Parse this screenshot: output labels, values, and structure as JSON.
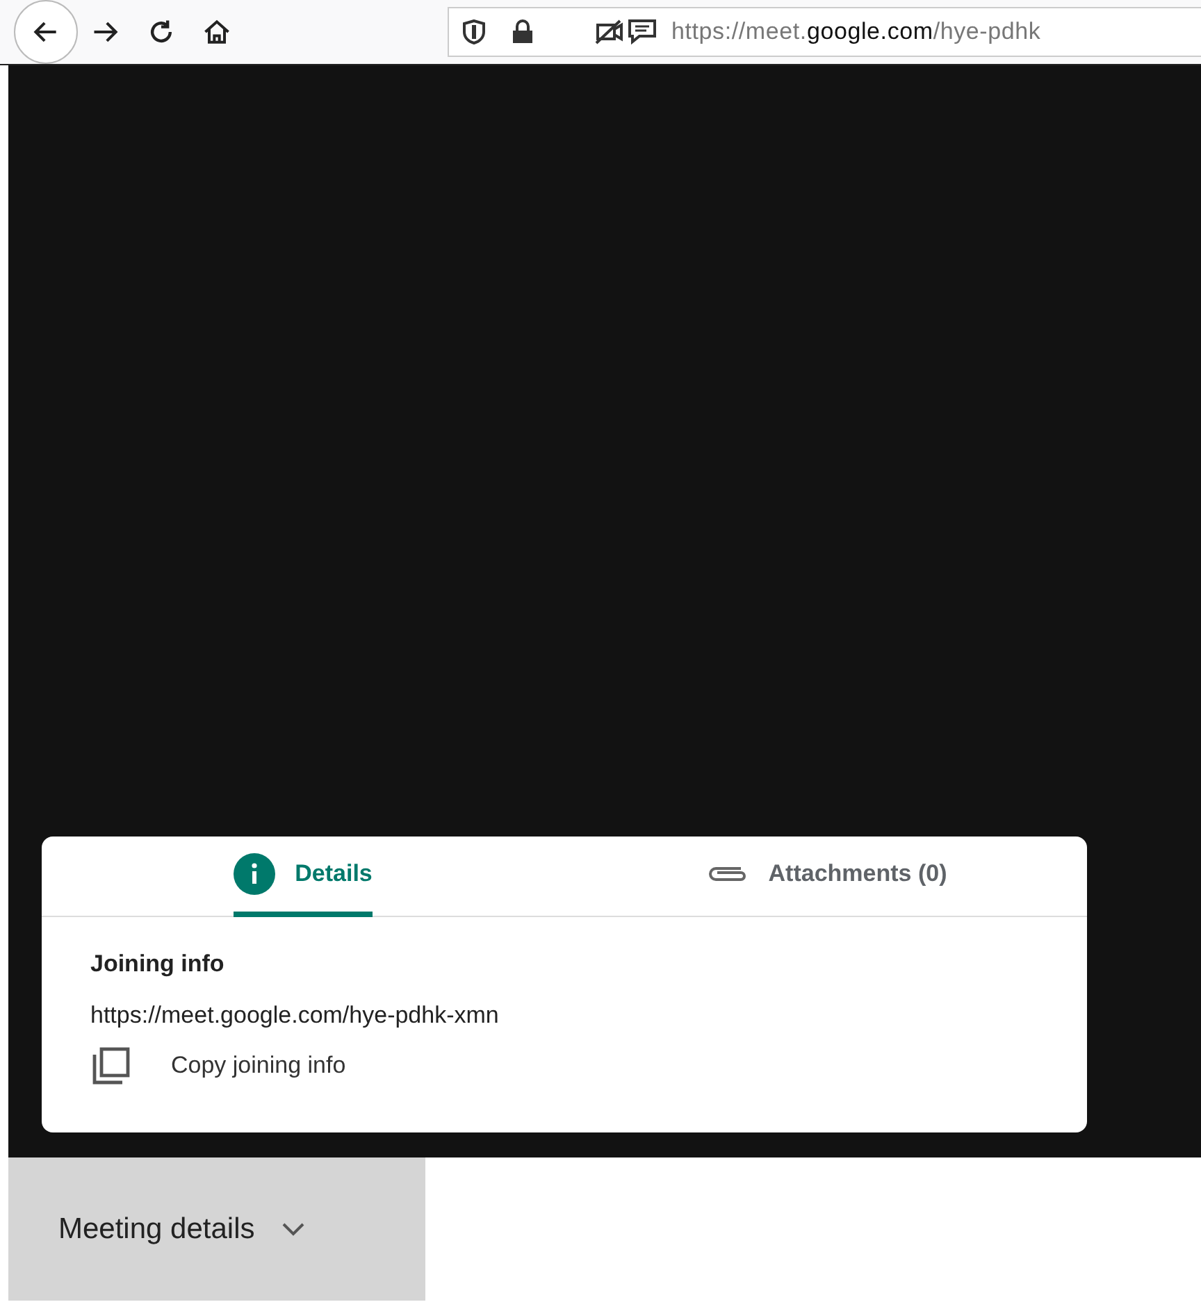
{
  "toolbar": {
    "url": {
      "scheme": "https://meet.",
      "domain": "google.com",
      "path": "/hye-pdhk"
    }
  },
  "panel": {
    "tabs": [
      {
        "label": "Details",
        "kind": "info",
        "selected": true
      },
      {
        "label": "Attachments (0)",
        "kind": "attachment",
        "selected": false
      }
    ],
    "heading": "Joining info",
    "link": "https://meet.google.com/hye-pdhk-xmn",
    "copy_label": "Copy joining info"
  },
  "footer": {
    "label": "Meeting details"
  }
}
